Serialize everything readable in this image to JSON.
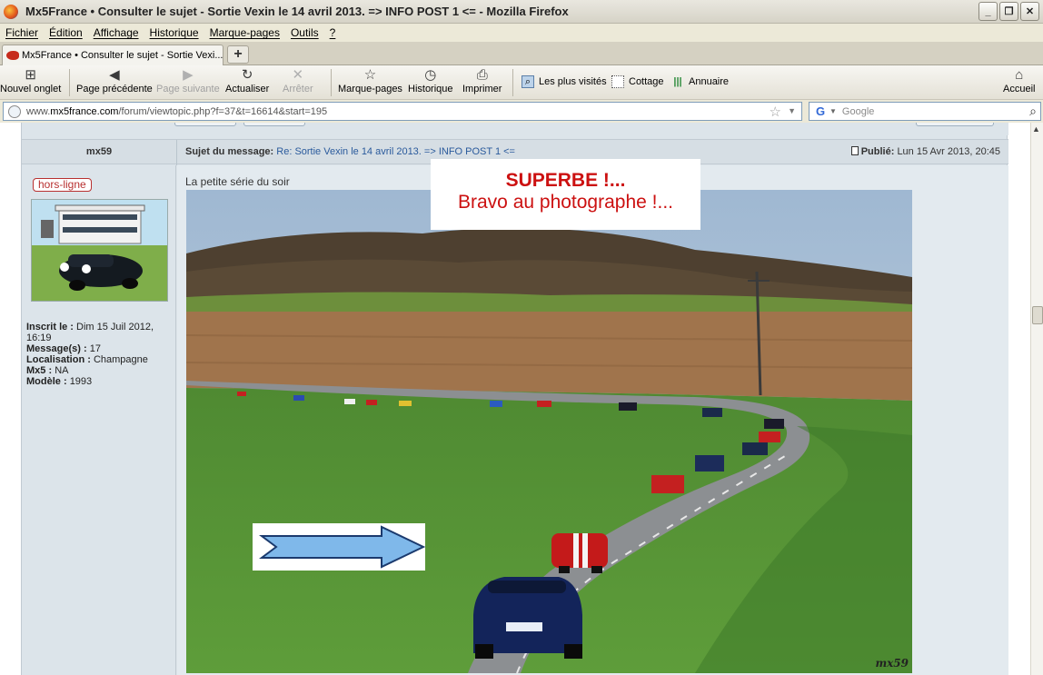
{
  "window": {
    "title": "Mx5France • Consulter le sujet - Sortie Vexin le 14 avril 2013. => INFO POST 1 <= - Mozilla Firefox",
    "minimize": "_",
    "maximize": "❐",
    "close": "✕"
  },
  "menu": [
    "Fichier",
    "Édition",
    "Affichage",
    "Historique",
    "Marque-pages",
    "Outils",
    "?"
  ],
  "tab": {
    "title": "Mx5France • Consulter le sujet - Sortie Vexi...",
    "close": "✕",
    "new": "+"
  },
  "toolbar": {
    "new_tab": "Nouvel onglet",
    "back": "Page précédente",
    "forward": "Page suivante",
    "reload": "Actualiser",
    "stop": "Arrêter",
    "bookmarks": "Marque-pages",
    "history": "Historique",
    "print": "Imprimer",
    "most_visited": "Les plus visités",
    "cottage": "Cottage",
    "directory": "Annuaire",
    "home": "Accueil"
  },
  "url": {
    "prefix": "www.",
    "domain": "mx5france.com",
    "path": "/forum/viewtopic.php?f=37&t=16614&start=195"
  },
  "search": {
    "placeholder": "Google"
  },
  "post": {
    "author": "mx59",
    "status": "hors-ligne",
    "subject_label": "Sujet du message:",
    "subject": "Re: Sortie Vexin le 14 avril 2013. => INFO POST 1 <=",
    "published_label": "Publié:",
    "published": "Lun 15 Avr 2013, 20:45",
    "caption": "La petite série du soir",
    "watermark": "mx59"
  },
  "profile": {
    "joined_label": "Inscrit le :",
    "joined": "Dim 15 Juil 2012, 16:19",
    "messages_label": "Message(s) :",
    "messages": "17",
    "location_label": "Localisation :",
    "location": "Champagne",
    "mx5_label": "Mx5 :",
    "mx5": "NA",
    "model_label": "Modèle :",
    "model": "1993"
  },
  "callout": {
    "line1": "SUPERBE !...",
    "line2": "Bravo au photographe !..."
  },
  "colors": {
    "accent_red": "#cc1111",
    "link": "#2a5a9c",
    "forum_bg": "#dce4ea"
  }
}
